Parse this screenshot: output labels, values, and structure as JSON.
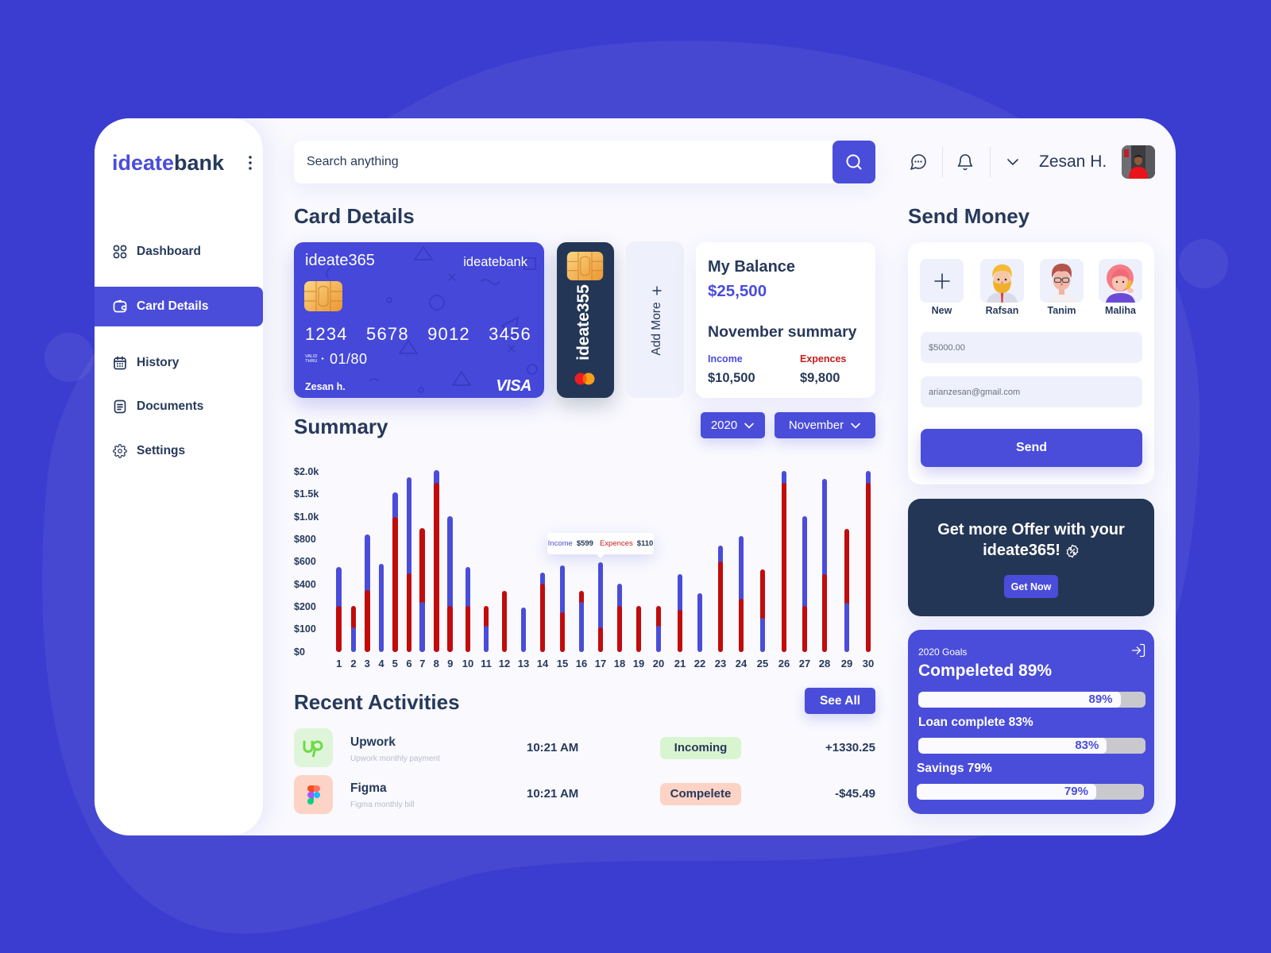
{
  "brand": {
    "part1": "ideate",
    "part2": "bank"
  },
  "colors": {
    "background": "#3b3dd0",
    "primary": "#4a4dd9",
    "navy_text": "#27395b",
    "dark_card": "#233655",
    "income": "#4a4dd9",
    "expenses": "#c20b0b",
    "incoming_badge": "#d8f5d0",
    "complete_badge": "#fcd3c5"
  },
  "sidebar": {
    "menu_icon": "kebab-icon",
    "items": [
      {
        "label": "Dashboard",
        "icon": "dashboard-grid-icon",
        "active": false
      },
      {
        "label": "Card Details",
        "icon": "wallet-icon",
        "active": true
      },
      {
        "label": "History",
        "icon": "calendar-icon",
        "active": false
      },
      {
        "label": "Documents",
        "icon": "document-icon",
        "active": false
      },
      {
        "label": "Settings",
        "icon": "gear-icon",
        "active": false
      }
    ]
  },
  "header": {
    "search_placeholder": "Search anything",
    "search_icon": "search-icon",
    "chat_icon": "chat-icon",
    "bell_icon": "bell-icon",
    "dropdown_icon": "chevron-down-icon",
    "user_name": "Zesan H."
  },
  "card_details": {
    "title": "Card Details",
    "primary_card": {
      "name": "ideate365",
      "bank": "ideatebank",
      "number": "1234 5678 9012 3456",
      "valid_line1": "VALID",
      "valid_line2": "THRU",
      "valid_arrow": "▸",
      "expiry": "01/80",
      "holder": "Zesan h.",
      "network": "VISA"
    },
    "secondary_card": {
      "name": "ideate355",
      "network_icon": "mastercard-icon"
    },
    "add_more_label": "Add More"
  },
  "balance": {
    "title": "My Balance",
    "amount": "$25,500",
    "summary_title": "November summary",
    "income_label": "Income",
    "income_value": "$10,500",
    "expense_label": "Expences",
    "expense_value": "$9,800"
  },
  "summary": {
    "title": "Summary",
    "year": "2020",
    "month": "November"
  },
  "chart_data": {
    "type": "bar",
    "title": "Summary",
    "layout": "overlapping bars (shorter series drawn in front of taller)",
    "categories": [
      "1",
      "2",
      "3",
      "4",
      "5",
      "6",
      "7",
      "8",
      "9",
      "10",
      "11",
      "12",
      "13",
      "14",
      "15",
      "16",
      "17",
      "18",
      "19",
      "20",
      "21",
      "22",
      "23",
      "24",
      "25",
      "26",
      "27",
      "28",
      "29",
      "30"
    ],
    "series": [
      {
        "name": "Income",
        "color": "#4a4dd9",
        "values": [
          550,
          110,
          840,
          580,
          1550,
          1880,
          240,
          2040,
          1020,
          550,
          115,
          0,
          195,
          505,
          570,
          240,
          599,
          405,
          0,
          115,
          490,
          320,
          745,
          830,
          150,
          2020,
          1010,
          1850,
          235,
          2020
        ]
      },
      {
        "name": "Expences",
        "color": "#c20b0b",
        "values": [
          210,
          210,
          350,
          0,
          1000,
          500,
          900,
          1750,
          210,
          210,
          210,
          340,
          0,
          405,
          175,
          345,
          110,
          210,
          210,
          210,
          185,
          0,
          605,
          270,
          535,
          1750,
          210,
          490,
          890,
          1750
        ]
      }
    ],
    "y_ticks": [
      {
        "value": 0,
        "label": "$0"
      },
      {
        "value": 100,
        "label": "$100"
      },
      {
        "value": 200,
        "label": "$200"
      },
      {
        "value": 400,
        "label": "$400"
      },
      {
        "value": 600,
        "label": "$600"
      },
      {
        "value": 800,
        "label": "$800"
      },
      {
        "value": 1000,
        "label": "$1.0k"
      },
      {
        "value": 1500,
        "label": "$1.5k"
      },
      {
        "value": 2000,
        "label": "$2.0k"
      }
    ],
    "y_scale": "piecewise-linear, equally spaced ticks",
    "ylim": [
      0,
      2000
    ],
    "xlabel": "",
    "ylabel": "",
    "grid": false,
    "legend": "none",
    "tooltip": {
      "day": 17,
      "income_label": "Income",
      "income_value": "$599",
      "expense_label": "Expences",
      "expense_value": "$110"
    }
  },
  "recent": {
    "title": "Recent Activities",
    "see_all": "See All",
    "items": [
      {
        "name": "Upwork",
        "subtitle": "Upwork monthly payment",
        "time": "10:21 AM",
        "status": "Incoming",
        "amount": "+1330.25",
        "icon": "upwork-logo-icon"
      },
      {
        "name": "Figma",
        "subtitle": "Figma monthly bill",
        "time": "10:21 AM",
        "status": "Compelete",
        "amount": "-$45.49",
        "icon": "figma-logo-icon"
      }
    ]
  },
  "send_money": {
    "title": "Send Money",
    "contacts": [
      {
        "name": "New",
        "icon": "plus-icon"
      },
      {
        "name": "Rafsan",
        "icon": "avatar-rafsan"
      },
      {
        "name": "Tanim",
        "icon": "avatar-tanim"
      },
      {
        "name": "Maliha",
        "icon": "avatar-maliha"
      }
    ],
    "amount_value": "$5000.00",
    "email_value": "arianzesan@gmail.com",
    "send_label": "Send"
  },
  "offer": {
    "line1": "Get more Offer with your",
    "line2": "ideate365!",
    "badge_icon": "discount-badge-icon",
    "button": "Get Now"
  },
  "goals": {
    "title": "2020 Goals",
    "headline": "Compeleted 89%",
    "export_icon": "login-icon",
    "bars": [
      {
        "label": "",
        "percent": 89,
        "text": "89%"
      },
      {
        "label": "Loan complete 83%",
        "percent": 83,
        "text": "83%"
      },
      {
        "label": "Savings 79%",
        "percent": 79,
        "text": "79%"
      }
    ]
  }
}
